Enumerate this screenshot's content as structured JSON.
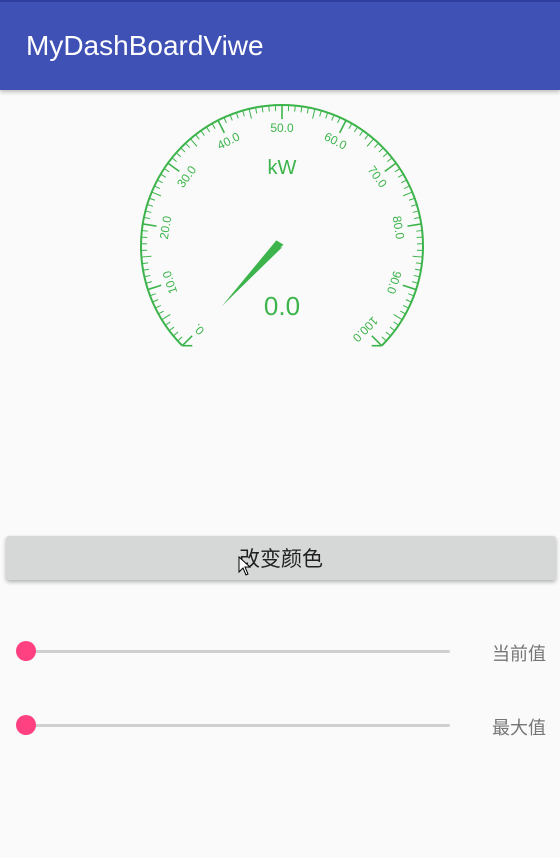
{
  "app": {
    "title": "MyDashBoardViwe",
    "bar_color": "#3f51b5"
  },
  "gauge": {
    "unit": "kW",
    "value_text": "0.0",
    "value": 0,
    "min": 0,
    "max": 100,
    "major_step": 10,
    "tick_labels": [
      "0.",
      "10.0",
      "20.0",
      "30.0",
      "40.0",
      "50.0",
      "60.0",
      "70.0",
      "80.0",
      "90.0",
      "100.0"
    ],
    "color": "#3cb44b"
  },
  "button": {
    "label": "改变颜色"
  },
  "sliders": [
    {
      "label": "当前值",
      "value": 0
    },
    {
      "label": "最大值",
      "value": 0
    }
  ],
  "colors": {
    "accent": "#ff4081",
    "gauge": "#3cb44b",
    "primary": "#3f51b5"
  }
}
